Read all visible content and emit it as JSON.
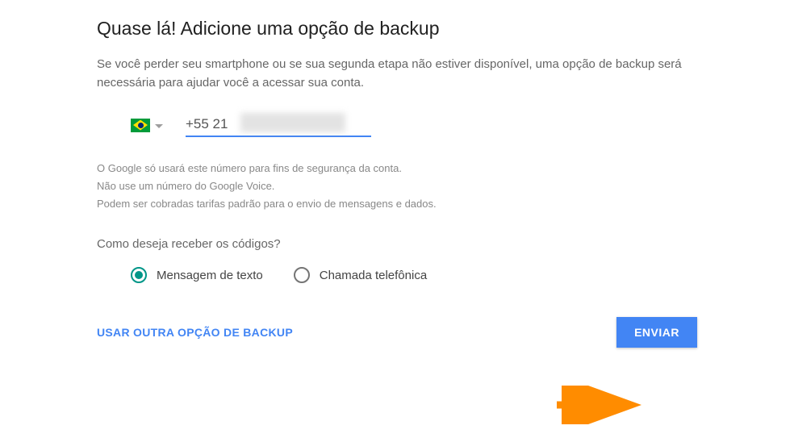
{
  "header": {
    "title": "Quase lá! Adicione uma opção de backup",
    "description": "Se você perder seu smartphone ou se sua segunda etapa não estiver disponível, uma opção de backup será necessária para ajudar você a acessar sua conta."
  },
  "phone": {
    "country": "Brazil",
    "value": "+55 21"
  },
  "disclaimer": {
    "line1": "O Google só usará este número para fins de segurança da conta.",
    "line2": "Não use um número do Google Voice.",
    "line3": "Podem ser cobradas tarifas padrão para o envio de mensagens e dados."
  },
  "codes": {
    "question": "Como deseja receber os códigos?",
    "options": [
      {
        "label": "Mensagem de texto",
        "selected": true
      },
      {
        "label": "Chamada telefônica",
        "selected": false
      }
    ]
  },
  "actions": {
    "other_option": "USAR OUTRA OPÇÃO DE BACKUP",
    "send": "ENVIAR"
  }
}
